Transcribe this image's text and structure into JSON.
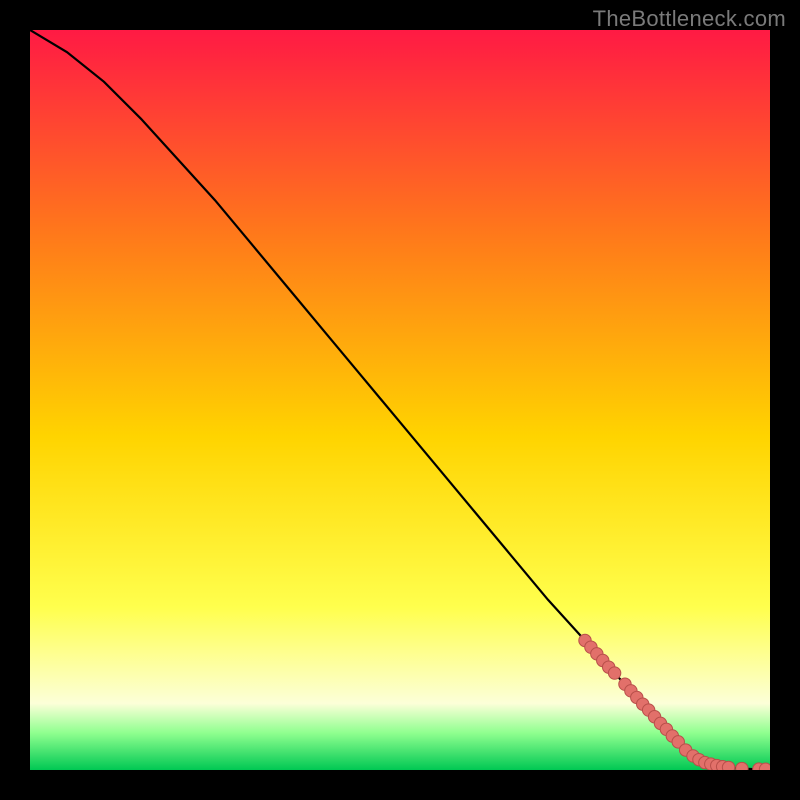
{
  "watermark": "TheBottleneck.com",
  "colors": {
    "curve": "#000000",
    "marker_fill": "#e2706a",
    "marker_stroke": "#b84f4a",
    "gradient_top": "#ff1a44",
    "gradient_mid1": "#ff7a1a",
    "gradient_mid2": "#ffd400",
    "gradient_mid3": "#ffff4d",
    "gradient_low": "#fcffd8",
    "gradient_green_hi": "#8fff8f",
    "gradient_green_lo": "#00c853"
  },
  "chart_data": {
    "type": "line",
    "title": "",
    "xlabel": "",
    "ylabel": "",
    "xlim": [
      0,
      100
    ],
    "ylim": [
      0,
      100
    ],
    "series": [
      {
        "name": "curve",
        "x": [
          0,
          5,
          10,
          15,
          20,
          25,
          30,
          35,
          40,
          45,
          50,
          55,
          60,
          65,
          70,
          75,
          80,
          85,
          88,
          90,
          92,
          94,
          96,
          98,
          100
        ],
        "y": [
          100,
          97,
          93,
          88,
          82.5,
          77,
          71,
          65,
          59,
          53,
          47,
          41,
          35,
          29,
          23,
          17.5,
          12,
          6.5,
          3.3,
          1.8,
          0.9,
          0.4,
          0.2,
          0.1,
          0.1
        ]
      }
    ],
    "markers": [
      {
        "x": 75.0,
        "y": 17.5
      },
      {
        "x": 75.8,
        "y": 16.6
      },
      {
        "x": 76.6,
        "y": 15.7
      },
      {
        "x": 77.4,
        "y": 14.8
      },
      {
        "x": 78.2,
        "y": 13.9
      },
      {
        "x": 79.0,
        "y": 13.1
      },
      {
        "x": 80.4,
        "y": 11.6
      },
      {
        "x": 81.2,
        "y": 10.7
      },
      {
        "x": 82.0,
        "y": 9.8
      },
      {
        "x": 82.8,
        "y": 8.9
      },
      {
        "x": 83.6,
        "y": 8.1
      },
      {
        "x": 84.4,
        "y": 7.2
      },
      {
        "x": 85.2,
        "y": 6.3
      },
      {
        "x": 86.0,
        "y": 5.5
      },
      {
        "x": 86.8,
        "y": 4.6
      },
      {
        "x": 87.6,
        "y": 3.8
      },
      {
        "x": 88.6,
        "y": 2.7
      },
      {
        "x": 89.6,
        "y": 1.9
      },
      {
        "x": 90.4,
        "y": 1.4
      },
      {
        "x": 91.2,
        "y": 1.0
      },
      {
        "x": 92.0,
        "y": 0.8
      },
      {
        "x": 92.8,
        "y": 0.6
      },
      {
        "x": 93.6,
        "y": 0.45
      },
      {
        "x": 94.4,
        "y": 0.35
      },
      {
        "x": 96.2,
        "y": 0.2
      },
      {
        "x": 98.5,
        "y": 0.12
      },
      {
        "x": 99.4,
        "y": 0.1
      }
    ]
  }
}
